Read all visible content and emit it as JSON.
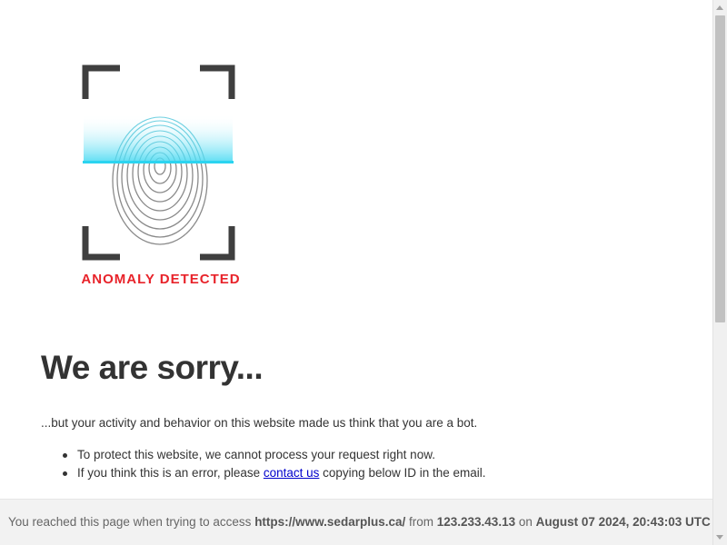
{
  "logo": {
    "caption": "ANOMALY DETECTED",
    "icon": "fingerprint-scan-icon",
    "caption_color": "#e8232a",
    "scan_color": "#2bd4f0"
  },
  "heading": "We are sorry...",
  "intro": "...but your activity and behavior on this website made us think that you are a bot.",
  "reasons": {
    "item1": "To protect this website, we cannot process your request right now.",
    "item2_before": "If you think this is an error, please ",
    "item2_link": "contact us",
    "item2_after": " copying below ID in the email."
  },
  "footer": {
    "prefix": "You reached this page when trying to access ",
    "url": "https://www.sedarplus.ca/",
    "from_label": " from ",
    "ip": "123.233.43.13",
    "on_label": " on ",
    "timestamp": "August 07 2024, 20:43:03 UTC"
  }
}
